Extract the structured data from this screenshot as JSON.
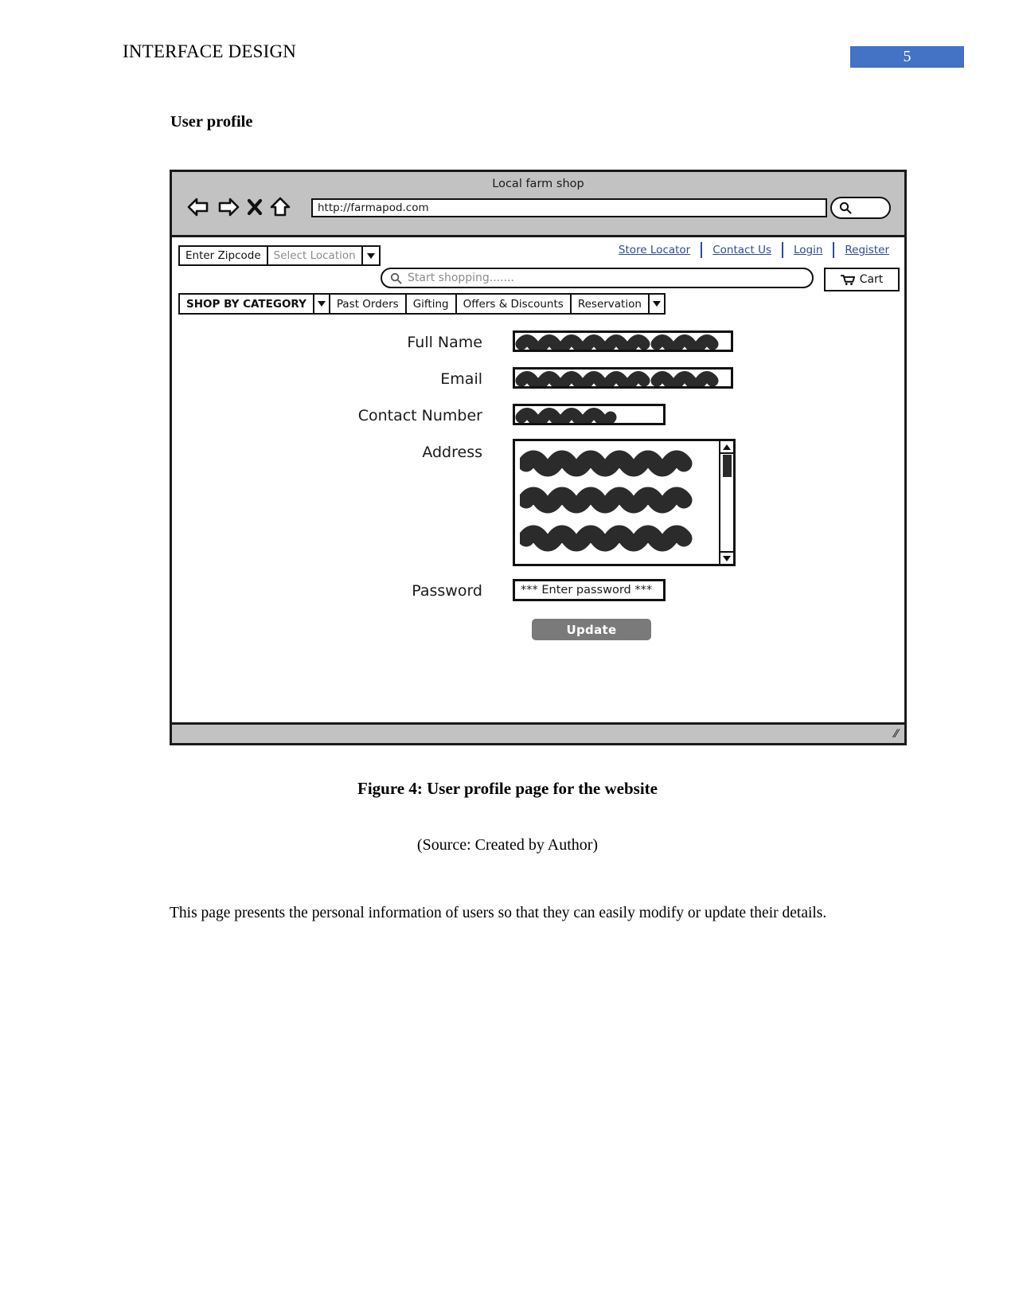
{
  "document": {
    "header_title": "INTERFACE DESIGN",
    "page_number": "5",
    "section_heading": "User profile",
    "caption": "Figure 4: User profile page for the website",
    "source": "(Source: Created by Author)",
    "body_paragraph": "This page presents the personal information of users so that they can easily modify or update their details.",
    "page_number_color": "#4472C4"
  },
  "mockup": {
    "browser": {
      "window_title": "Local farm shop",
      "url_value": "http://farmapod.com",
      "nav_icons": [
        "back-arrow-icon",
        "forward-arrow-icon",
        "close-x-icon",
        "home-icon"
      ],
      "search_icon": "magnifier-icon"
    },
    "topbar": {
      "zipcode_label": "Enter Zipcode",
      "location_placeholder": "Select Location",
      "links": [
        "Store Locator",
        "Contact Us",
        "Login",
        "Register"
      ],
      "search_placeholder": "Start shopping.......",
      "cart_label": "Cart"
    },
    "menubar": {
      "items": [
        "SHOP BY CATEGORY",
        "Past Orders",
        "Gifting",
        "Offers & Discounts",
        "Reservation"
      ]
    },
    "form": {
      "fields": [
        {
          "label": "Full Name",
          "value_style": "scribble-long"
        },
        {
          "label": "Email",
          "value_style": "scribble-long"
        },
        {
          "label": "Contact Number",
          "value_style": "scribble-short"
        },
        {
          "label": "Address",
          "value_style": "scribble-textarea"
        }
      ],
      "password_label": "Password",
      "password_value": "*** Enter password ***",
      "submit_label": "Update",
      "submit_color": "#7a7a7a"
    }
  }
}
